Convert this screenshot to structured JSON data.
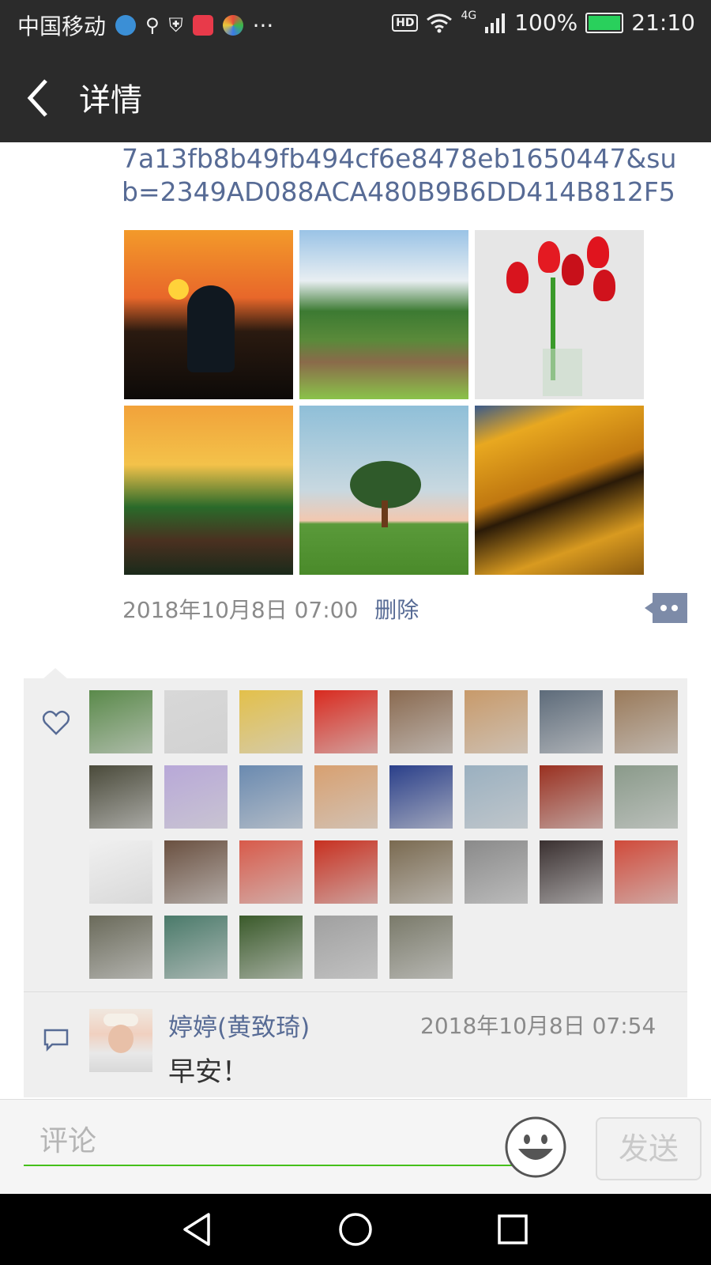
{
  "status_bar": {
    "carrier": "中国移动",
    "network": "4G",
    "hd_label": "HD",
    "battery": "100%",
    "time": "21:10",
    "icons": [
      "globe-icon",
      "usb-icon",
      "shield-icon",
      "music-app-icon",
      "color-app-icon",
      "more-dots-icon"
    ]
  },
  "header": {
    "title": "详情",
    "back_icon": "chevron-left-icon"
  },
  "post": {
    "link_text": "7a13fb8b49fb494cf6e8478eb1650447&sub=2349AD088ACA480B9B6DD414B812F5",
    "photos": [
      {
        "name": "photo-heron-sunset"
      },
      {
        "name": "photo-mountain-village"
      },
      {
        "name": "photo-red-tulips"
      },
      {
        "name": "photo-pavilion-sunset"
      },
      {
        "name": "photo-lone-tree"
      },
      {
        "name": "photo-golden-canyon"
      }
    ],
    "timestamp": "2018年10月8日 07:00",
    "delete_label": "删除",
    "more_icon": "comment-dots-icon"
  },
  "likes": {
    "icon": "heart-icon",
    "avatar_count": 29,
    "avatar_colors": [
      "#5a8a4a",
      "#d8d8d8",
      "#e3c04a",
      "#d92a1f",
      "#8a6a50",
      "#c89a6a",
      "#5d6b7a",
      "#9a7a5a",
      "#4a4a3a",
      "#b8a8d8",
      "#6a8ab0",
      "#d8a070",
      "#2a3f8a",
      "#9ab0c0",
      "#9a3020",
      "#8a9a8a",
      "#f0f0f0",
      "#6a5040",
      "#d85a4a",
      "#c83020",
      "#7a6a50",
      "#8a8a8a",
      "#3a3030",
      "#d04a3a",
      "#6a6a5a",
      "#4a7a6a",
      "#3a5a2a",
      "#a0a0a0",
      "#7a7a6a"
    ]
  },
  "comment": {
    "icon": "comment-bubble-icon",
    "author": "婷婷(黄致琦)",
    "time": "2018年10月8日 07:54",
    "text": "早安！"
  },
  "input": {
    "placeholder": "评论",
    "emoji_icon": "smiley-icon",
    "send_label": "发送"
  },
  "nav": {
    "icons": [
      "back-triangle-icon",
      "home-circle-icon",
      "recents-square-icon"
    ]
  }
}
